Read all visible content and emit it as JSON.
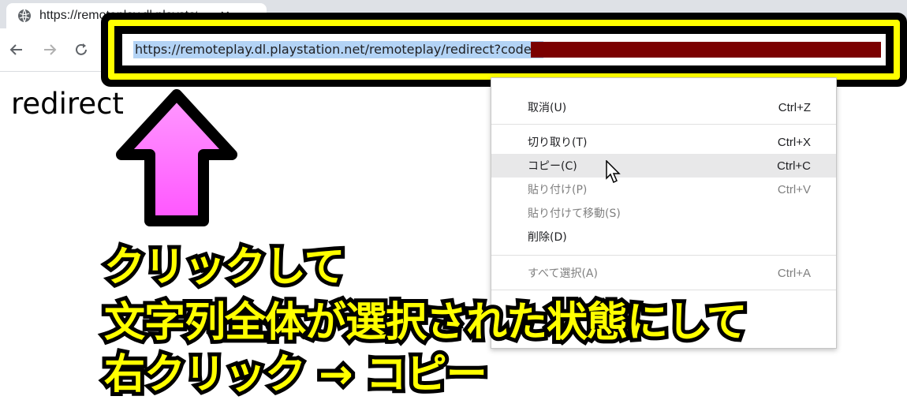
{
  "browser": {
    "tab_title": "https://remoteplay.dl.playstation.net",
    "tab_close": "✕",
    "favicon": "globe-icon"
  },
  "toolbar": {
    "url": "https://remoteplay.dl.playstation.net/remoteplay/redirect?code="
  },
  "page": {
    "heading": "redirect"
  },
  "context_menu": {
    "items": [
      {
        "label": "取消(U)",
        "shortcut": "Ctrl+Z",
        "enabled": true
      },
      {
        "label": "切り取り(T)",
        "shortcut": "Ctrl+X",
        "enabled": true
      },
      {
        "label": "コピー(C)",
        "shortcut": "Ctrl+C",
        "enabled": true,
        "hover": true
      },
      {
        "label": "貼り付け(P)",
        "shortcut": "Ctrl+V",
        "enabled": false
      },
      {
        "label": "貼り付けて移動(S)",
        "shortcut": "",
        "enabled": false
      },
      {
        "label": "削除(D)",
        "shortcut": "",
        "enabled": true
      },
      {
        "label": "すべて選択(A)",
        "shortcut": "Ctrl+A",
        "enabled": false
      }
    ]
  },
  "annotation": {
    "line1": "クリックして",
    "line2": "文字列全体が選択された状態にして",
    "line3": "右クリック → コピー"
  },
  "colors": {
    "highlight_yellow": "#ffff00",
    "arrow_pink": "#ff66ff",
    "redaction": "#7b0000",
    "selection": "#b3d3f5"
  }
}
